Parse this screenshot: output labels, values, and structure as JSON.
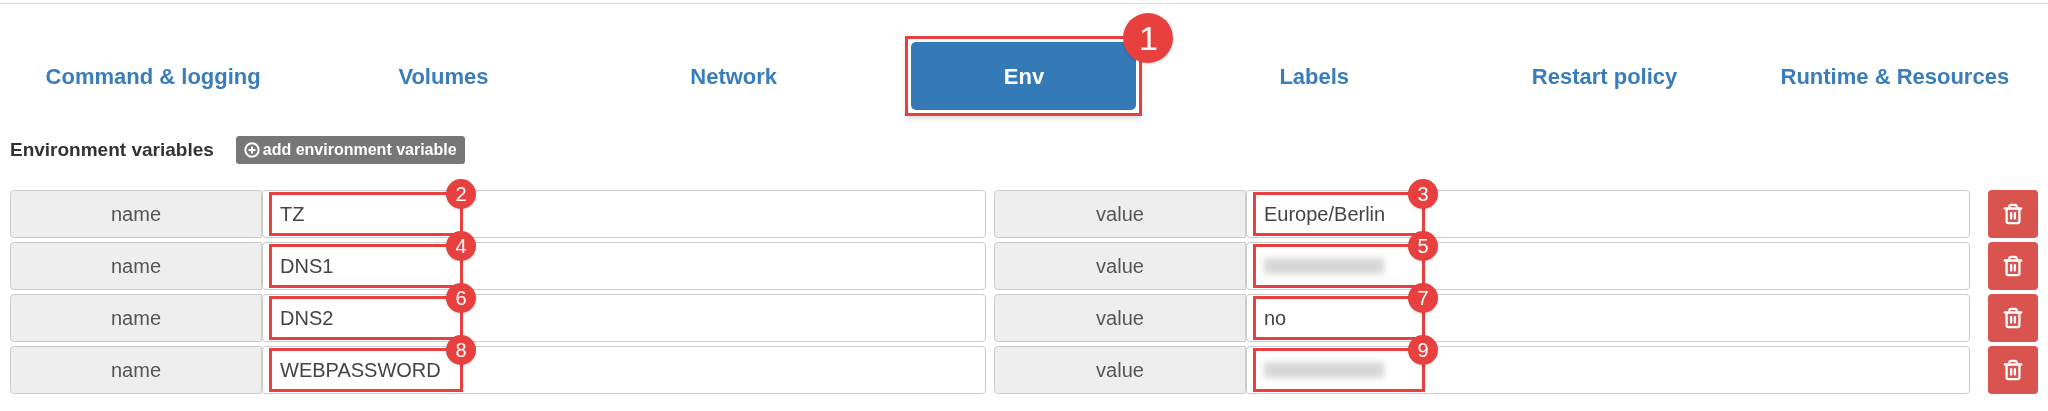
{
  "tabs": [
    {
      "label": "Command & logging",
      "selected": false
    },
    {
      "label": "Volumes",
      "selected": false
    },
    {
      "label": "Network",
      "selected": false
    },
    {
      "label": "Env",
      "selected": true,
      "marker": "1"
    },
    {
      "label": "Labels",
      "selected": false
    },
    {
      "label": "Restart policy",
      "selected": false
    },
    {
      "label": "Runtime & Resources",
      "selected": false
    }
  ],
  "section": {
    "title": "Environment variables",
    "add_button": "add environment variable"
  },
  "variables": [
    {
      "name_label": "name",
      "name": "TZ",
      "name_marker": "2",
      "value_label": "value",
      "value": "Europe/Berlin",
      "value_blurred": false,
      "value_marker": "3"
    },
    {
      "name_label": "name",
      "name": "DNS1",
      "name_marker": "4",
      "value_label": "value",
      "value_blurred": true,
      "value_marker": "5"
    },
    {
      "name_label": "name",
      "name": "DNS2",
      "name_marker": "6",
      "value_label": "value",
      "value": "no",
      "value_blurred": false,
      "value_marker": "7"
    },
    {
      "name_label": "name",
      "name": "WEBPASSWORD",
      "name_marker": "8",
      "value_label": "value",
      "value_blurred": true,
      "value_marker": "9"
    }
  ]
}
